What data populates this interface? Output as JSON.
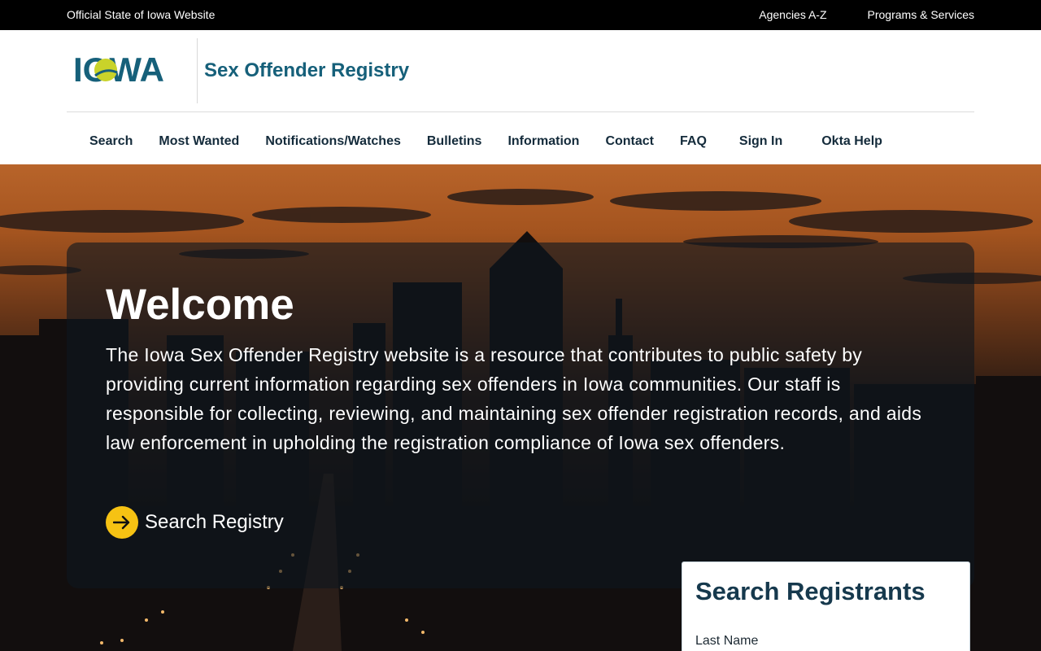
{
  "top_bar": {
    "official": "Official State of Iowa Website",
    "links": [
      "Agencies A-Z",
      "Programs & Services"
    ]
  },
  "header": {
    "logo_text": "IOWA",
    "site_title": "Sex Offender Registry"
  },
  "nav": {
    "items": [
      "Search",
      "Most Wanted",
      "Notifications/Watches",
      "Bulletins",
      "Information",
      "Contact",
      "FAQ",
      "Sign In",
      "Okta Help"
    ]
  },
  "hero": {
    "title": "Welcome",
    "text": "The Iowa Sex Offender Registry website is a resource that contributes to public safety by providing current information regarding sex offenders in Iowa communities. Our staff is responsible for collecting, reviewing, and maintaining sex offender registration records, and aids law enforcement in upholding the registration compliance of Iowa sex offenders.",
    "cta_label": "Search Registry"
  },
  "search_card": {
    "title": "Search Registrants",
    "last_name_label": "Last Name"
  },
  "colors": {
    "brand_teal": "#16607a",
    "nav_text": "#142b3b",
    "accent_yellow": "#f6c213",
    "top_bar_bg": "#000000"
  },
  "icons": [
    "arrow-right-icon"
  ]
}
